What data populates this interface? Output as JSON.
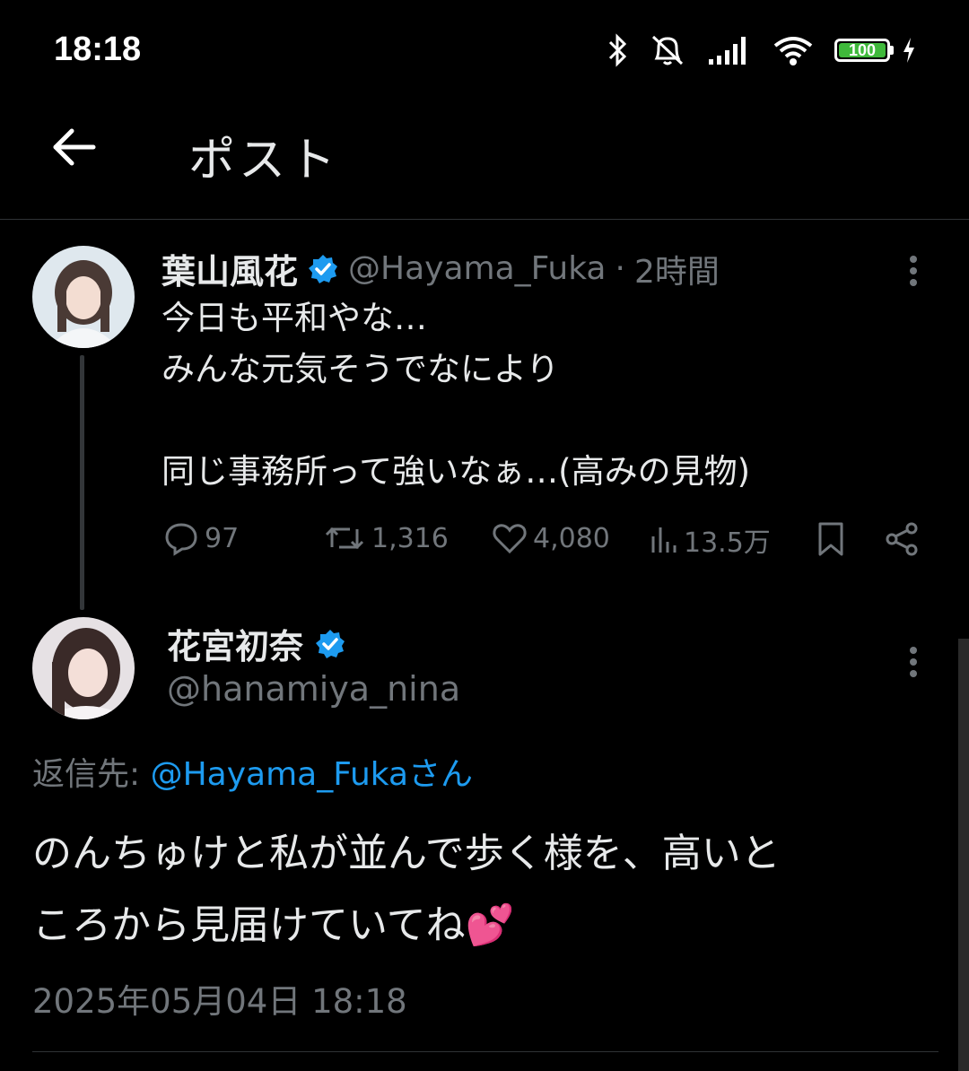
{
  "status_bar": {
    "time": "18:18",
    "battery": "100",
    "icons": [
      "bluetooth-icon",
      "mute-icon",
      "signal-icon",
      "wifi-icon",
      "battery-icon",
      "charging-icon"
    ]
  },
  "header": {
    "title": "ポスト"
  },
  "parent_post": {
    "name": "葉山風花",
    "handle": "@Hayama_Fuka",
    "separator": "·",
    "time": "2時間",
    "lines": [
      "今日も平和やな…",
      "みんな元気そうでなにより",
      "",
      "同じ事務所って強いなぁ…(高みの見物)"
    ],
    "stats": {
      "replies": "97",
      "reposts": "1,316",
      "likes": "4,080",
      "views": "13.5万"
    }
  },
  "main_post": {
    "name": "花宮初奈",
    "handle": "@hanamiya_nina",
    "reply_to_label": "返信先:",
    "reply_to_handle": "@Hayama_Fukaさん",
    "lines": [
      "のんちゅけと私が並んで歩く様を、高いと",
      "ころから見届けていてね"
    ],
    "emoji": "💕",
    "timestamp": "2025年05月04日 18:18"
  },
  "colors": {
    "accent": "#1d9bf0",
    "muted": "#71767b",
    "text": "#e7e9ea",
    "background": "#000000"
  }
}
